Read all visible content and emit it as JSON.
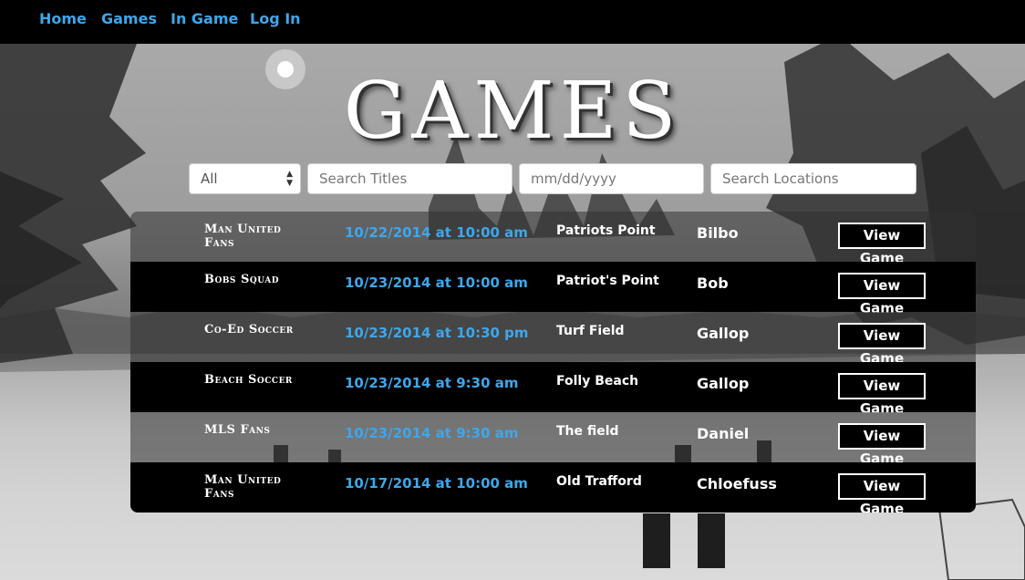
{
  "nav": {
    "links": [
      {
        "label": "Home"
      },
      {
        "label": "Games"
      },
      {
        "label": "In Game"
      },
      {
        "label": "Log In"
      }
    ]
  },
  "page_title": "GAMES",
  "filters": {
    "category_selected": "All",
    "title_placeholder": "Search Titles",
    "date_placeholder": "mm/dd/yyyy",
    "location_placeholder": "Search Locations"
  },
  "games": [
    {
      "title": "Man United Fans",
      "datetime": "10/22/2014 at 10:00 am",
      "location": "Patriots Point",
      "host": "Bilbo",
      "action": "View Game"
    },
    {
      "title": "Bobs Squad",
      "datetime": "10/23/2014 at 10:00 am",
      "location": "Patriot's Point",
      "host": "Bob",
      "action": "View Game"
    },
    {
      "title": "Co-Ed Soccer",
      "datetime": "10/23/2014 at 10:30 pm",
      "location": "Turf Field",
      "host": "Gallop",
      "action": "View Game"
    },
    {
      "title": "Beach Soccer",
      "datetime": "10/23/2014 at 9:30 am",
      "location": "Folly Beach",
      "host": "Gallop",
      "action": "View Game"
    },
    {
      "title": "MLS Fans",
      "datetime": "10/23/2014 at 9:30 am",
      "location": "The field",
      "host": "Daniel",
      "action": "View Game"
    },
    {
      "title": "Man United Fans",
      "datetime": "10/17/2014 at 10:00 am",
      "location": "Old Trafford",
      "host": "Chloefuss",
      "action": "View Game"
    }
  ],
  "colors": {
    "accent": "#3da7ec",
    "navbar_bg": "#000000",
    "row_dark": "#000000"
  }
}
